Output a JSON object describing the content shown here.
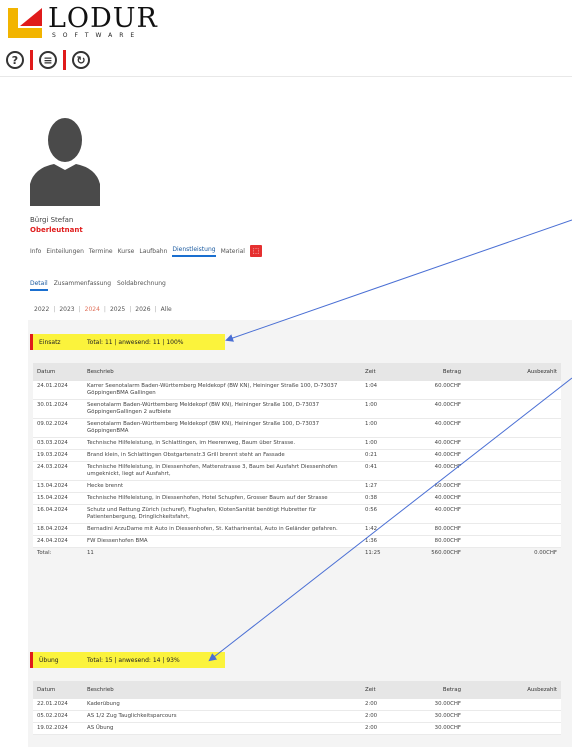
{
  "logo": {
    "name": "LODUR",
    "sub": "SOFTWARE"
  },
  "toolbar": {
    "help": "?",
    "list": "≡",
    "refresh": "↻"
  },
  "profile": {
    "name": "Bürgi Stefan",
    "rank": "Oberleutnant"
  },
  "tabs": [
    "Info",
    "Einteilungen",
    "Termine",
    "Kurse",
    "Laufbahn",
    "Dienstleistung",
    "Material"
  ],
  "active_tab": "Dienstleistung",
  "subtabs": [
    "Detail",
    "Zusammenfassung",
    "Soldabrechnung"
  ],
  "years": [
    "2022",
    "2023",
    "2024",
    "2025",
    "2026",
    "Alle"
  ],
  "active_year": "2024",
  "einsatz": {
    "title": "Einsatz",
    "summary": "Total: 11 | anwesend: 11 | 100%",
    "headers": {
      "datum": "Datum",
      "beschrieb": "Beschrieb",
      "zeit": "Zeit",
      "betrag": "Betrag",
      "ausbezahlt": "Ausbezahlt"
    },
    "rows": [
      {
        "datum": "24.01.2024",
        "beschrieb": "Karrer Seenotalarm Baden-Württemberg Meldekopf (BW KN), Heininger Straße 100, D-73037 GöppingenBMA Gallingen",
        "zeit": "1:04",
        "betrag": "60.00CHF",
        "ausbezahlt": ""
      },
      {
        "datum": "30.01.2024",
        "beschrieb": "Seenotalarm Baden-Württemberg Meldekopf (BW KN), Heininger Straße 100, D-73037 GöppingenGallingen 2 aufbiete",
        "zeit": "1:00",
        "betrag": "40.00CHF",
        "ausbezahlt": ""
      },
      {
        "datum": "09.02.2024",
        "beschrieb": "Seenotalarm Baden-Württemberg Meldekopf (BW KN), Heininger Straße 100, D-73037 GöppingenBMA",
        "zeit": "1:00",
        "betrag": "40.00CHF",
        "ausbezahlt": ""
      },
      {
        "datum": "03.03.2024",
        "beschrieb": "Technische Hilfeleistung, in Schlattingen, im Heerenweg, Baum über Strasse.",
        "zeit": "1:00",
        "betrag": "40.00CHF",
        "ausbezahlt": ""
      },
      {
        "datum": "19.03.2024",
        "beschrieb": "Brand klein, in Schlattingen Obstgartenstr.3 Grill brennt steht an Fassade",
        "zeit": "0:21",
        "betrag": "40.00CHF",
        "ausbezahlt": ""
      },
      {
        "datum": "24.03.2024",
        "beschrieb": "Technische Hilfeleistung, in Diessenhofen, Mattenstrasse 3, Baum bei Ausfahrt Diessenhofen umgeknickt, liegt auf Ausfahrt,",
        "zeit": "0:41",
        "betrag": "40.00CHF",
        "ausbezahlt": ""
      },
      {
        "datum": "13.04.2024",
        "beschrieb": "Hecke brennt",
        "zeit": "1:27",
        "betrag": "60.00CHF",
        "ausbezahlt": ""
      },
      {
        "datum": "15.04.2024",
        "beschrieb": "Technische Hilfeleistung, in Diessenhofen, Hotel Schupfen, Grosser Baum auf der Strasse",
        "zeit": "0:38",
        "betrag": "40.00CHF",
        "ausbezahlt": ""
      },
      {
        "datum": "16.04.2024",
        "beschrieb": "Schutz und Rettung Zürich (schuref), Flughafen, KlotenSanität benötigt Hubretter für Patientenbergung, Dringlichkeitsfahrt,",
        "zeit": "0:56",
        "betrag": "40.00CHF",
        "ausbezahlt": ""
      },
      {
        "datum": "18.04.2024",
        "beschrieb": "Bernadini ArzuDame mit Auto in Diessenhofen, St. Katharinental, Auto in Geländer gefahren.",
        "zeit": "1:42",
        "betrag": "80.00CHF",
        "ausbezahlt": ""
      },
      {
        "datum": "24.04.2024",
        "beschrieb": "FW Diessenhofen BMA",
        "zeit": "1:36",
        "betrag": "80.00CHF",
        "ausbezahlt": ""
      }
    ],
    "total": {
      "label": "Total:",
      "count": "11",
      "zeit": "11:25",
      "betrag": "560.00CHF",
      "ausbezahlt": "0.00CHF"
    }
  },
  "uebung": {
    "title": "Übung",
    "summary": "Total: 15 | anwesend: 14 | 93%",
    "headers": {
      "datum": "Datum",
      "beschrieb": "Beschrieb",
      "zeit": "Zeit",
      "betrag": "Betrag",
      "ausbezahlt": "Ausbezahlt"
    },
    "rows": [
      {
        "datum": "22.01.2024",
        "beschrieb": "Kaderübung",
        "zeit": "2:00",
        "betrag": "30.00CHF",
        "ausbezahlt": ""
      },
      {
        "datum": "05.02.2024",
        "beschrieb": "AS 1/2 Zug Tauglichkeitsparcours",
        "zeit": "2:00",
        "betrag": "30.00CHF",
        "ausbezahlt": ""
      },
      {
        "datum": "19.02.2024",
        "beschrieb": "AS Übung",
        "zeit": "2:00",
        "betrag": "30.00CHF",
        "ausbezahlt": ""
      }
    ]
  },
  "colors": {
    "accent": "#e01b1b",
    "highlight": "#fbf33c",
    "link": "#1a6fd0",
    "arrow": "#4a6fd4"
  }
}
